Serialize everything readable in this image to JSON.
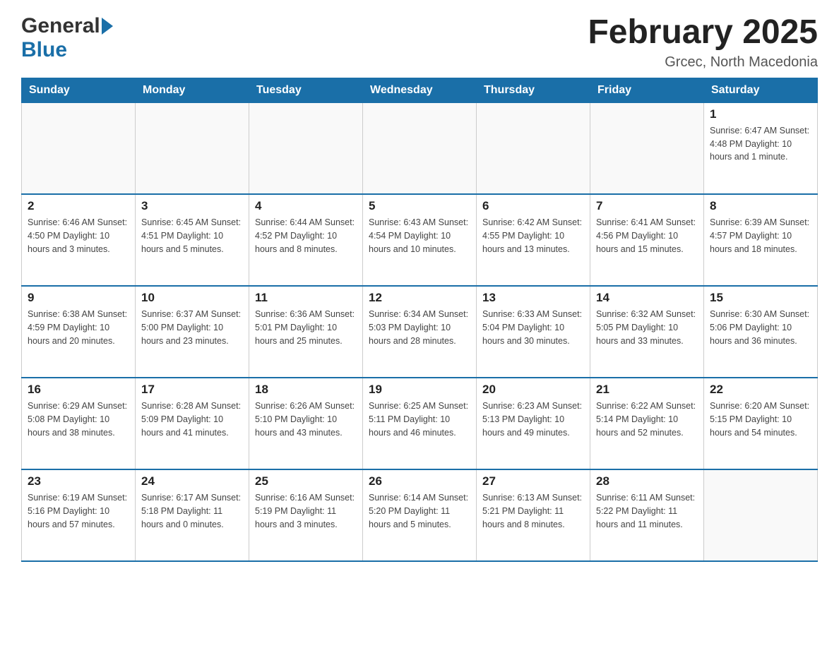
{
  "header": {
    "title": "February 2025",
    "subtitle": "Grcec, North Macedonia"
  },
  "logo": {
    "line1": "General",
    "line2": "Blue"
  },
  "days_of_week": [
    "Sunday",
    "Monday",
    "Tuesday",
    "Wednesday",
    "Thursday",
    "Friday",
    "Saturday"
  ],
  "weeks": [
    [
      {
        "day": "",
        "info": ""
      },
      {
        "day": "",
        "info": ""
      },
      {
        "day": "",
        "info": ""
      },
      {
        "day": "",
        "info": ""
      },
      {
        "day": "",
        "info": ""
      },
      {
        "day": "",
        "info": ""
      },
      {
        "day": "1",
        "info": "Sunrise: 6:47 AM\nSunset: 4:48 PM\nDaylight: 10 hours and 1 minute."
      }
    ],
    [
      {
        "day": "2",
        "info": "Sunrise: 6:46 AM\nSunset: 4:50 PM\nDaylight: 10 hours and 3 minutes."
      },
      {
        "day": "3",
        "info": "Sunrise: 6:45 AM\nSunset: 4:51 PM\nDaylight: 10 hours and 5 minutes."
      },
      {
        "day": "4",
        "info": "Sunrise: 6:44 AM\nSunset: 4:52 PM\nDaylight: 10 hours and 8 minutes."
      },
      {
        "day": "5",
        "info": "Sunrise: 6:43 AM\nSunset: 4:54 PM\nDaylight: 10 hours and 10 minutes."
      },
      {
        "day": "6",
        "info": "Sunrise: 6:42 AM\nSunset: 4:55 PM\nDaylight: 10 hours and 13 minutes."
      },
      {
        "day": "7",
        "info": "Sunrise: 6:41 AM\nSunset: 4:56 PM\nDaylight: 10 hours and 15 minutes."
      },
      {
        "day": "8",
        "info": "Sunrise: 6:39 AM\nSunset: 4:57 PM\nDaylight: 10 hours and 18 minutes."
      }
    ],
    [
      {
        "day": "9",
        "info": "Sunrise: 6:38 AM\nSunset: 4:59 PM\nDaylight: 10 hours and 20 minutes."
      },
      {
        "day": "10",
        "info": "Sunrise: 6:37 AM\nSunset: 5:00 PM\nDaylight: 10 hours and 23 minutes."
      },
      {
        "day": "11",
        "info": "Sunrise: 6:36 AM\nSunset: 5:01 PM\nDaylight: 10 hours and 25 minutes."
      },
      {
        "day": "12",
        "info": "Sunrise: 6:34 AM\nSunset: 5:03 PM\nDaylight: 10 hours and 28 minutes."
      },
      {
        "day": "13",
        "info": "Sunrise: 6:33 AM\nSunset: 5:04 PM\nDaylight: 10 hours and 30 minutes."
      },
      {
        "day": "14",
        "info": "Sunrise: 6:32 AM\nSunset: 5:05 PM\nDaylight: 10 hours and 33 minutes."
      },
      {
        "day": "15",
        "info": "Sunrise: 6:30 AM\nSunset: 5:06 PM\nDaylight: 10 hours and 36 minutes."
      }
    ],
    [
      {
        "day": "16",
        "info": "Sunrise: 6:29 AM\nSunset: 5:08 PM\nDaylight: 10 hours and 38 minutes."
      },
      {
        "day": "17",
        "info": "Sunrise: 6:28 AM\nSunset: 5:09 PM\nDaylight: 10 hours and 41 minutes."
      },
      {
        "day": "18",
        "info": "Sunrise: 6:26 AM\nSunset: 5:10 PM\nDaylight: 10 hours and 43 minutes."
      },
      {
        "day": "19",
        "info": "Sunrise: 6:25 AM\nSunset: 5:11 PM\nDaylight: 10 hours and 46 minutes."
      },
      {
        "day": "20",
        "info": "Sunrise: 6:23 AM\nSunset: 5:13 PM\nDaylight: 10 hours and 49 minutes."
      },
      {
        "day": "21",
        "info": "Sunrise: 6:22 AM\nSunset: 5:14 PM\nDaylight: 10 hours and 52 minutes."
      },
      {
        "day": "22",
        "info": "Sunrise: 6:20 AM\nSunset: 5:15 PM\nDaylight: 10 hours and 54 minutes."
      }
    ],
    [
      {
        "day": "23",
        "info": "Sunrise: 6:19 AM\nSunset: 5:16 PM\nDaylight: 10 hours and 57 minutes."
      },
      {
        "day": "24",
        "info": "Sunrise: 6:17 AM\nSunset: 5:18 PM\nDaylight: 11 hours and 0 minutes."
      },
      {
        "day": "25",
        "info": "Sunrise: 6:16 AM\nSunset: 5:19 PM\nDaylight: 11 hours and 3 minutes."
      },
      {
        "day": "26",
        "info": "Sunrise: 6:14 AM\nSunset: 5:20 PM\nDaylight: 11 hours and 5 minutes."
      },
      {
        "day": "27",
        "info": "Sunrise: 6:13 AM\nSunset: 5:21 PM\nDaylight: 11 hours and 8 minutes."
      },
      {
        "day": "28",
        "info": "Sunrise: 6:11 AM\nSunset: 5:22 PM\nDaylight: 11 hours and 11 minutes."
      },
      {
        "day": "",
        "info": ""
      }
    ]
  ]
}
